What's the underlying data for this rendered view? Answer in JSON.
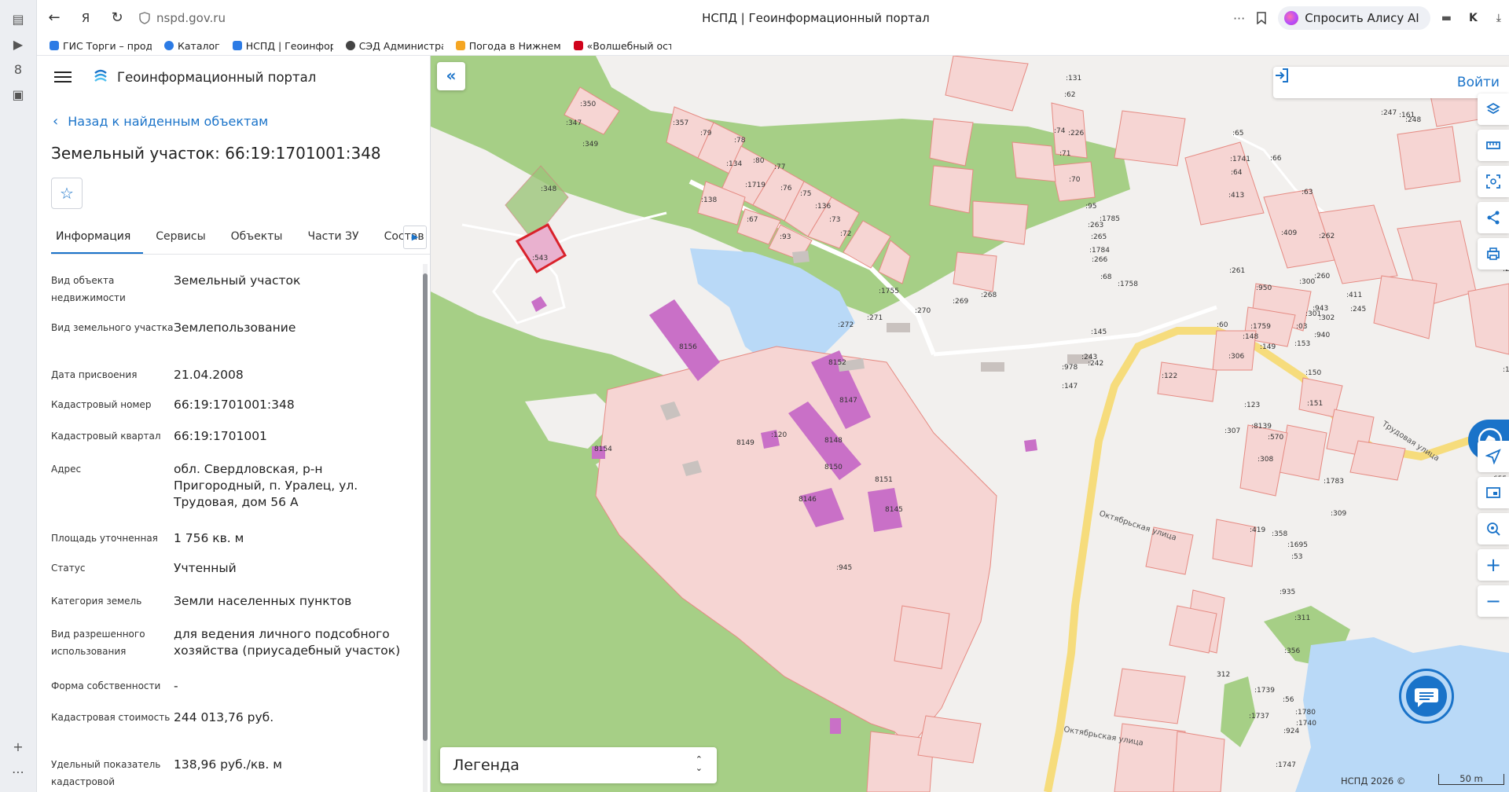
{
  "browser": {
    "url": "nspd.gov.ru",
    "tab_title": "НСПД | Геоинформационный портал",
    "alice_label": "Спросить Алису AI",
    "bookmarks": [
      {
        "label": "ГИС Торги – прод",
        "color": "#2c7be5"
      },
      {
        "label": "Каталог",
        "color": "#2c7be5"
      },
      {
        "label": "НСПД | Геоинфор",
        "color": "#2c7be5"
      },
      {
        "label": "СЭД Администра",
        "color": "#444444"
      },
      {
        "label": "Погода в Нижнем",
        "color": "#f5a623"
      },
      {
        "label": "«Волшебный остр",
        "color": "#d0021b"
      }
    ]
  },
  "panel": {
    "portal_title": "Геоинформационный портал",
    "back_label": "Назад к найденным объектам",
    "object_title": "Земельный участок: 66:19:1701001:348",
    "tabs": [
      "Информация",
      "Сервисы",
      "Объекты",
      "Части ЗУ",
      "Состав"
    ],
    "properties": [
      {
        "label": "Вид объекта недвижимости",
        "value": "Земельный участок"
      },
      {
        "label": "Вид земельного участка",
        "value": "Землепользование"
      },
      {
        "label": "Дата присвоения",
        "value": "21.04.2008"
      },
      {
        "label": "Кадастровый номер",
        "value": "66:19:1701001:348"
      },
      {
        "label": "Кадастровый квартал",
        "value": "66:19:1701001"
      },
      {
        "label": "Адрес",
        "value": "обл. Свердловская, р-н Пригородный, п. Уралец, ул. Трудовая, дом 56 А"
      },
      {
        "label": "Площадь уточненная",
        "value": "1 756 кв. м"
      },
      {
        "label": "Статус",
        "value": "Учтенный"
      },
      {
        "label": "Категория земель",
        "value": "Земли населенных пунктов"
      },
      {
        "label": "Вид разрешенного использования",
        "value": "для ведения личного подсобного хозяйства (приусадебный участок)"
      },
      {
        "label": "Форма собственности",
        "value": "-"
      },
      {
        "label": "Кадастровая стоимость",
        "value": "244 013,76 руб."
      },
      {
        "label": "Удельный показатель кадастровой",
        "value": "138,96 руб./кв. м"
      }
    ]
  },
  "map": {
    "login_label": "Войти",
    "legend_label": "Легенда",
    "copyright": "НСПД 2026 ©",
    "scale_label": "50 m",
    "zoom_in": "+",
    "zoom_out": "−",
    "street_labels": [
      "Трудовая улица",
      "Октябрьская улица"
    ],
    "parcel_labels": [
      ":350",
      ":347",
      ":349",
      ":348",
      ":357",
      ":79",
      ":78",
      ":134",
      ":80",
      ":77",
      ":1719",
      ":76",
      ":75",
      ":136",
      ":73",
      ":72",
      ":138",
      ":67",
      ":93",
      ":543",
      ":1755",
      ":272",
      ":271",
      ":270",
      ":269",
      ":268",
      ":131",
      ":62",
      ":74",
      ":71",
      ":70",
      ":95",
      ":263",
      ":265",
      ":1785",
      ":1784",
      ":266",
      ":68",
      ":1758",
      ":145",
      ":243",
      ":242",
      ":978",
      ":147",
      ":122",
      ":60",
      ":148",
      ":1759",
      ":149",
      ":153",
      ":306",
      ":150",
      ":151",
      ":123",
      ":570",
      ":307",
      ":8139",
      ":308",
      ":1783",
      ":309",
      ":419",
      ":358",
      ":1695",
      ":53",
      ":935",
      ":311",
      ":356",
      "312",
      ":1739",
      ":56",
      ":1780",
      ":1737",
      ":1740",
      ":924",
      ":1747",
      "8156",
      "8154",
      "8152",
      "8147",
      "8148",
      "8149",
      ":120",
      "8150",
      "8146",
      "8145",
      "8151",
      ":945",
      ":226",
      ":65",
      ":1741",
      ":66",
      ":64",
      ":413",
      ":63",
      ":409",
      ":262",
      ":261",
      ":260",
      ":300",
      ":950",
      ":943",
      ":301",
      ":411",
      ":245",
      ":302",
      ":940",
      ":03",
      ":248",
      ":161",
      ":247",
      ":298",
      ":299",
      ":17",
      ":659",
      ":655"
    ]
  },
  "colors": {
    "accent": "#1a73c9",
    "parcel_fill": "#f6d5d3",
    "parcel_stroke": "#e58a82",
    "selected_stroke": "#d9222b",
    "building": "#c970c7",
    "forest": "#a6cf86",
    "water": "#b9d9f7",
    "road": "#f6dc7c"
  }
}
